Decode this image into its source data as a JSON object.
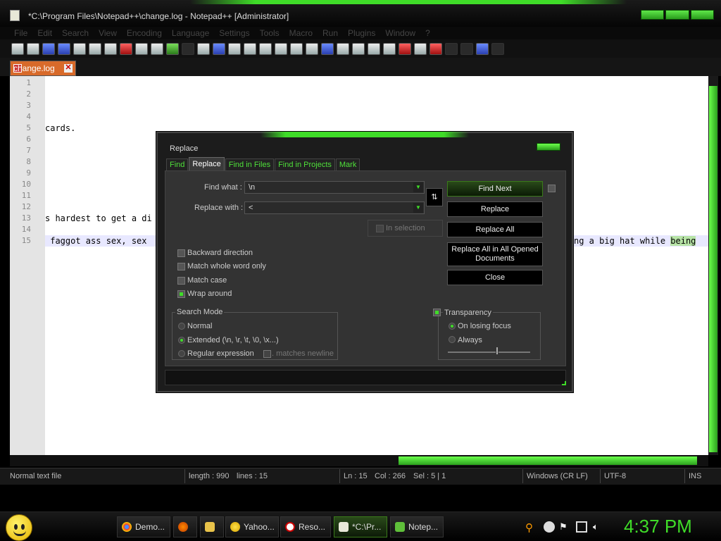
{
  "window": {
    "title": "*C:\\Program Files\\Notepad++\\change.log - Notepad++ [Administrator]"
  },
  "menu": [
    "File",
    "Edit",
    "Search",
    "View",
    "Encoding",
    "Language",
    "Settings",
    "Tools",
    "Macro",
    "Run",
    "Plugins",
    "Window",
    "?"
  ],
  "document_tab": {
    "label": "change.log"
  },
  "editor": {
    "line_numbers": [
      "1",
      "2",
      "3",
      "4",
      "5",
      "6",
      "7",
      "8",
      "9",
      "10",
      "11",
      "12",
      "13",
      "14",
      "15"
    ],
    "line5_text": "cards.",
    "line13_text": "s hardest to get a di",
    "line15_left": " faggot ass sex, sex",
    "line15_right": "ng a big hat while ",
    "line15_highlight": "being"
  },
  "dialog": {
    "title": "Replace",
    "tabs": [
      "Find",
      "Replace",
      "Find in Files",
      "Find in Projects",
      "Mark"
    ],
    "find_what_label": "Find what :",
    "find_what_value": "\\n",
    "replace_with_label": "Replace with :",
    "replace_with_value": "<",
    "swap_label": "⇅",
    "buttons": {
      "find_next": "Find Next",
      "replace": "Replace",
      "replace_all": "Replace All",
      "replace_all_opened": "Replace All in All Opened Documents",
      "close": "Close"
    },
    "in_selection": "In selection",
    "options": {
      "backward": "Backward direction",
      "whole_word": "Match whole word only",
      "match_case": "Match case",
      "wrap_around": "Wrap around"
    },
    "search_mode": {
      "title": "Search Mode",
      "normal": "Normal",
      "extended": "Extended (\\n, \\r, \\t, \\0, \\x...)",
      "regex": "Regular expression",
      "dot_newline": ". matches newline"
    },
    "transparency": {
      "title": "Transparency",
      "on_losing_focus": "On losing focus",
      "always": "Always",
      "level": 0.6
    }
  },
  "statusbar": {
    "file_type": "Normal text file",
    "length": "length : 990",
    "lines": "lines : 15",
    "ln": "Ln : 15",
    "col": "Col : 266",
    "sel": "Sel : 5 | 1",
    "eol": "Windows (CR LF)",
    "encoding": "UTF-8",
    "mode": "INS"
  },
  "taskbar": {
    "items": [
      "Demo...",
      "Yahoo...",
      "Reso...",
      "*C:\\Pr...",
      "Notep..."
    ],
    "clock": "4:37 PM"
  },
  "colors": {
    "accent": "#3fdc28",
    "editor_bg": "#ffffff",
    "chrome": "#1c1c1c"
  }
}
